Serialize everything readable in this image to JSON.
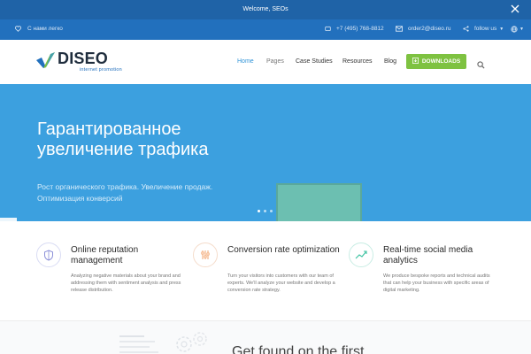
{
  "announcement": {
    "text": "Welcome, SEOs",
    "close_icon": "close-icon"
  },
  "topbar": {
    "slogan": "С нами легко",
    "phone": "+7 (495) 768-8812",
    "email": "order2@diseo.ru",
    "follow_label": "follow us",
    "icons": [
      "heart-icon",
      "phone-icon",
      "mail-icon",
      "share-icon",
      "globe-icon"
    ]
  },
  "header": {
    "logo_text": "DISEO",
    "logo_tagline": "internet promotion",
    "nav": [
      "Home",
      "Pages",
      "Case Studies",
      "Resources",
      "Blog"
    ],
    "active_nav": "Home",
    "downloads_label": "DOWNLOADS"
  },
  "hero": {
    "title": "Гарантированное увеличение трафика",
    "subtitle": "Рост органического трафика. Увеличение продаж. Оптимизация конверсий",
    "slide_count": 3,
    "active_slide": 0,
    "colors": {
      "background": "#3ca0df",
      "screen": "#6cbfb1"
    }
  },
  "features": [
    {
      "icon": "shield-icon",
      "title": "Online reputation management",
      "desc": "Analyzing negative materials about your brand and addressing them with sentiment analysis and press release distribution."
    },
    {
      "icon": "sliders-icon",
      "title": "Conversion rate optimization",
      "desc": "Turn your visitors into customers with our team of experts. We'll analyze your website and develop a conversion rate strategy."
    },
    {
      "icon": "chart-line-icon",
      "title": "Real-time social media analytics",
      "desc": "We produce bespoke reports and technical audits that can help your business with specific areas of digital marketing."
    }
  ],
  "bottom": {
    "heading": "Get found on the first"
  },
  "colors": {
    "announce_bg": "#1f63a7",
    "topbar_bg": "#2270bd",
    "accent": "#2f93d7",
    "download_btn": "#7ec241"
  }
}
